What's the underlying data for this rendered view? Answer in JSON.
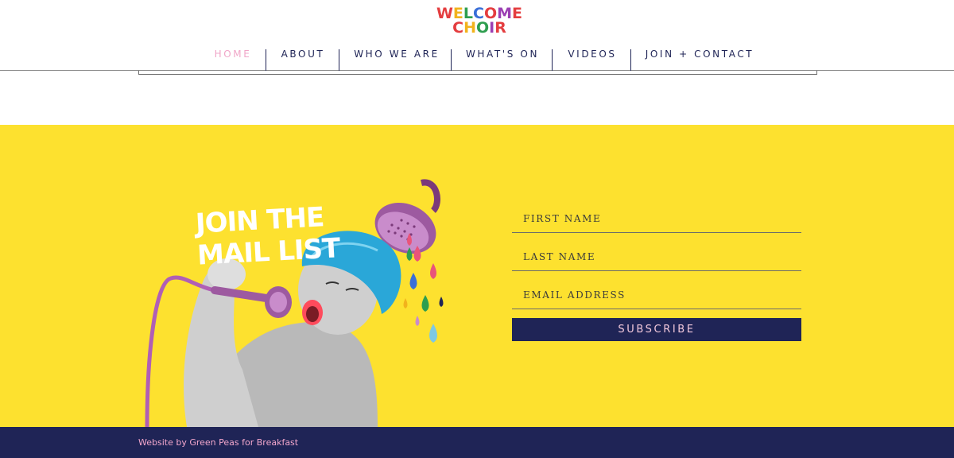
{
  "logo": {
    "line1": [
      "W",
      "E",
      "L",
      "C",
      "O",
      "M",
      "E"
    ],
    "line2": [
      "C",
      "H",
      "O",
      "I",
      "R"
    ],
    "line1_colors": [
      "#e43d3f",
      "#f2b31c",
      "#2e9e4f",
      "#3a6fd8",
      "#e43d3f",
      "#9b3fb3",
      "#e43d3f"
    ],
    "line2_colors": [
      "#e43d3f",
      "#f2b31c",
      "#2e9e4f",
      "#9b3fb3",
      "#e43d3f"
    ]
  },
  "nav": {
    "items": [
      "HOME",
      "ABOUT",
      "WHO WE ARE",
      "WHAT'S ON",
      "VIDEOS",
      "JOIN + CONTACT"
    ],
    "active": "HOME"
  },
  "hero": {
    "title_line1": "JOIN THE",
    "title_line2": "MAIL LIST",
    "image_icon": "singing-woman-shower-illustration"
  },
  "form": {
    "first_name_placeholder": "FIRST NAME",
    "last_name_placeholder": "LAST NAME",
    "email_placeholder": "EMAIL ADDRESS",
    "subscribe_label": "SUBSCRIBE"
  },
  "footer": {
    "credit": "Website by Green Peas for Breakfast"
  },
  "colors": {
    "navy": "#1f2456",
    "yellow": "#fde12f",
    "pink": "#f0a6c8"
  }
}
